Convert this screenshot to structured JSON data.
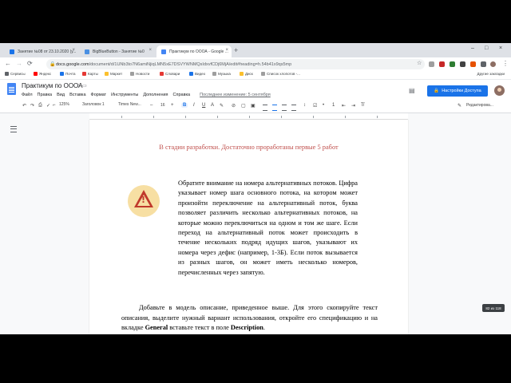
{
  "browser": {
    "tabs": [
      {
        "label": "Занятие №08 от 23.10.2020 (у...",
        "active": false,
        "favicon_color": "#1a73e8"
      },
      {
        "label": "BigBlueButton - Занятие №0",
        "active": false,
        "favicon_color": "#4a90e2"
      },
      {
        "label": "Практикум по ОООА - Google ...",
        "active": true,
        "favicon_color": "#4285f4"
      }
    ],
    "new_tab_symbol": "+",
    "tab_close_symbol": "×",
    "window_controls": [
      "–",
      "□",
      "×"
    ],
    "url_host": "docs.google.com",
    "url_path": "/document/d/1UNb3to7N6amiNjiqLMN5xE7DSVYWNMQsIdxvfCDj6MjA/edit#heading=h.54b41x9qs5mp",
    "nav": {
      "back": "←",
      "forward": "→",
      "reload": "⟳"
    },
    "bookmarks": [
      {
        "label": "Сервисы",
        "color": "#5f6368"
      },
      {
        "label": "Яндекс",
        "color": "#ff0000"
      },
      {
        "label": "Почта",
        "color": "#1a73e8"
      },
      {
        "label": "Карты",
        "color": "#e53935"
      },
      {
        "label": "Маркет",
        "color": "#fbc02d"
      },
      {
        "label": "Новости",
        "color": "#9e9e9e"
      },
      {
        "label": "Словари",
        "color": "#e53935"
      },
      {
        "label": "Видео",
        "color": "#1a73e8"
      },
      {
        "label": "Музыка",
        "color": "#9e9e9e"
      },
      {
        "label": "Диск",
        "color": "#fbc02d"
      },
      {
        "label": "Список хлопотов -...",
        "color": "#9e9e9e"
      }
    ],
    "other_bookmarks": "Другие закладки"
  },
  "docs": {
    "title": "Практикум по ОООА",
    "menu": [
      "Файл",
      "Правка",
      "Вид",
      "Вставка",
      "Формат",
      "Инструменты",
      "Дополнения",
      "Справка"
    ],
    "last_edit": "Последнее изменение: 5 сентября",
    "share_label": "Настройки Доступа",
    "toolbar": {
      "zoom": "125%",
      "style": "Заголовок 1",
      "font": "Times New...",
      "font_size": "16",
      "bold": "B",
      "italic": "I",
      "underline": "U",
      "text_color": "A",
      "minus": "–",
      "plus": "+",
      "edit_mode": "Редактирова..."
    },
    "accent_color": "#1a73e8"
  },
  "document": {
    "dev_note": "В стадии разработки. Достаточно проработаны первые 5 работ",
    "note_text": "Обратите внимание на номера альтернативных потоков. Цифра указывает номер шага основного потока, на котором может произойти переключение на альтернативный поток, буква позволяет различить несколько альтернативных потоков, на которые можно переключиться на одном и том же шаге. Если переход на альтернативный поток может происходить в течение нескольких подряд идущих шагов, указывают их номера через дефис (например, 1-3Б). Если поток вызывается из разных шагов, он может иметь несколько номеров, перечисленных через запятую.",
    "body_part1": "Добавьте в модель описание, приведенное выше. Для этого скопируйте текст описания, выделите нужный вариант использования, откройте его спецификацию и на вкладке ",
    "body_bold1": "General",
    "body_part2": " вставьте текст в поле ",
    "body_bold2": "Description",
    "body_part3": ".",
    "dev_note_color": "#c0504d",
    "warning_icon": "warning-triangle-icon"
  },
  "page_counter": "82 из 118"
}
